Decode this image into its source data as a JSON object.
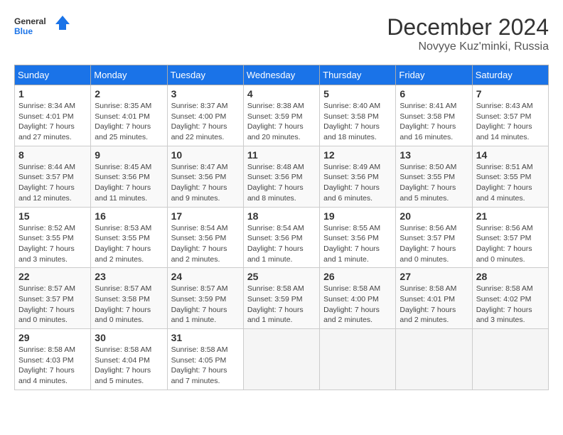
{
  "logo": {
    "line1": "General",
    "line2": "Blue"
  },
  "title": "December 2024",
  "location": "Novyye Kuz'minki, Russia",
  "headers": [
    "Sunday",
    "Monday",
    "Tuesday",
    "Wednesday",
    "Thursday",
    "Friday",
    "Saturday"
  ],
  "weeks": [
    [
      {
        "day": "1",
        "info": "Sunrise: 8:34 AM\nSunset: 4:01 PM\nDaylight: 7 hours\nand 27 minutes."
      },
      {
        "day": "2",
        "info": "Sunrise: 8:35 AM\nSunset: 4:01 PM\nDaylight: 7 hours\nand 25 minutes."
      },
      {
        "day": "3",
        "info": "Sunrise: 8:37 AM\nSunset: 4:00 PM\nDaylight: 7 hours\nand 22 minutes."
      },
      {
        "day": "4",
        "info": "Sunrise: 8:38 AM\nSunset: 3:59 PM\nDaylight: 7 hours\nand 20 minutes."
      },
      {
        "day": "5",
        "info": "Sunrise: 8:40 AM\nSunset: 3:58 PM\nDaylight: 7 hours\nand 18 minutes."
      },
      {
        "day": "6",
        "info": "Sunrise: 8:41 AM\nSunset: 3:58 PM\nDaylight: 7 hours\nand 16 minutes."
      },
      {
        "day": "7",
        "info": "Sunrise: 8:43 AM\nSunset: 3:57 PM\nDaylight: 7 hours\nand 14 minutes."
      }
    ],
    [
      {
        "day": "8",
        "info": "Sunrise: 8:44 AM\nSunset: 3:57 PM\nDaylight: 7 hours\nand 12 minutes."
      },
      {
        "day": "9",
        "info": "Sunrise: 8:45 AM\nSunset: 3:56 PM\nDaylight: 7 hours\nand 11 minutes."
      },
      {
        "day": "10",
        "info": "Sunrise: 8:47 AM\nSunset: 3:56 PM\nDaylight: 7 hours\nand 9 minutes."
      },
      {
        "day": "11",
        "info": "Sunrise: 8:48 AM\nSunset: 3:56 PM\nDaylight: 7 hours\nand 8 minutes."
      },
      {
        "day": "12",
        "info": "Sunrise: 8:49 AM\nSunset: 3:56 PM\nDaylight: 7 hours\nand 6 minutes."
      },
      {
        "day": "13",
        "info": "Sunrise: 8:50 AM\nSunset: 3:55 PM\nDaylight: 7 hours\nand 5 minutes."
      },
      {
        "day": "14",
        "info": "Sunrise: 8:51 AM\nSunset: 3:55 PM\nDaylight: 7 hours\nand 4 minutes."
      }
    ],
    [
      {
        "day": "15",
        "info": "Sunrise: 8:52 AM\nSunset: 3:55 PM\nDaylight: 7 hours\nand 3 minutes."
      },
      {
        "day": "16",
        "info": "Sunrise: 8:53 AM\nSunset: 3:55 PM\nDaylight: 7 hours\nand 2 minutes."
      },
      {
        "day": "17",
        "info": "Sunrise: 8:54 AM\nSunset: 3:56 PM\nDaylight: 7 hours\nand 2 minutes."
      },
      {
        "day": "18",
        "info": "Sunrise: 8:54 AM\nSunset: 3:56 PM\nDaylight: 7 hours\nand 1 minute."
      },
      {
        "day": "19",
        "info": "Sunrise: 8:55 AM\nSunset: 3:56 PM\nDaylight: 7 hours\nand 1 minute."
      },
      {
        "day": "20",
        "info": "Sunrise: 8:56 AM\nSunset: 3:57 PM\nDaylight: 7 hours\nand 0 minutes."
      },
      {
        "day": "21",
        "info": "Sunrise: 8:56 AM\nSunset: 3:57 PM\nDaylight: 7 hours\nand 0 minutes."
      }
    ],
    [
      {
        "day": "22",
        "info": "Sunrise: 8:57 AM\nSunset: 3:57 PM\nDaylight: 7 hours\nand 0 minutes."
      },
      {
        "day": "23",
        "info": "Sunrise: 8:57 AM\nSunset: 3:58 PM\nDaylight: 7 hours\nand 0 minutes."
      },
      {
        "day": "24",
        "info": "Sunrise: 8:57 AM\nSunset: 3:59 PM\nDaylight: 7 hours\nand 1 minute."
      },
      {
        "day": "25",
        "info": "Sunrise: 8:58 AM\nSunset: 3:59 PM\nDaylight: 7 hours\nand 1 minute."
      },
      {
        "day": "26",
        "info": "Sunrise: 8:58 AM\nSunset: 4:00 PM\nDaylight: 7 hours\nand 2 minutes."
      },
      {
        "day": "27",
        "info": "Sunrise: 8:58 AM\nSunset: 4:01 PM\nDaylight: 7 hours\nand 2 minutes."
      },
      {
        "day": "28",
        "info": "Sunrise: 8:58 AM\nSunset: 4:02 PM\nDaylight: 7 hours\nand 3 minutes."
      }
    ],
    [
      {
        "day": "29",
        "info": "Sunrise: 8:58 AM\nSunset: 4:03 PM\nDaylight: 7 hours\nand 4 minutes."
      },
      {
        "day": "30",
        "info": "Sunrise: 8:58 AM\nSunset: 4:04 PM\nDaylight: 7 hours\nand 5 minutes."
      },
      {
        "day": "31",
        "info": "Sunrise: 8:58 AM\nSunset: 4:05 PM\nDaylight: 7 hours\nand 7 minutes."
      },
      {
        "day": "",
        "info": ""
      },
      {
        "day": "",
        "info": ""
      },
      {
        "day": "",
        "info": ""
      },
      {
        "day": "",
        "info": ""
      }
    ]
  ]
}
